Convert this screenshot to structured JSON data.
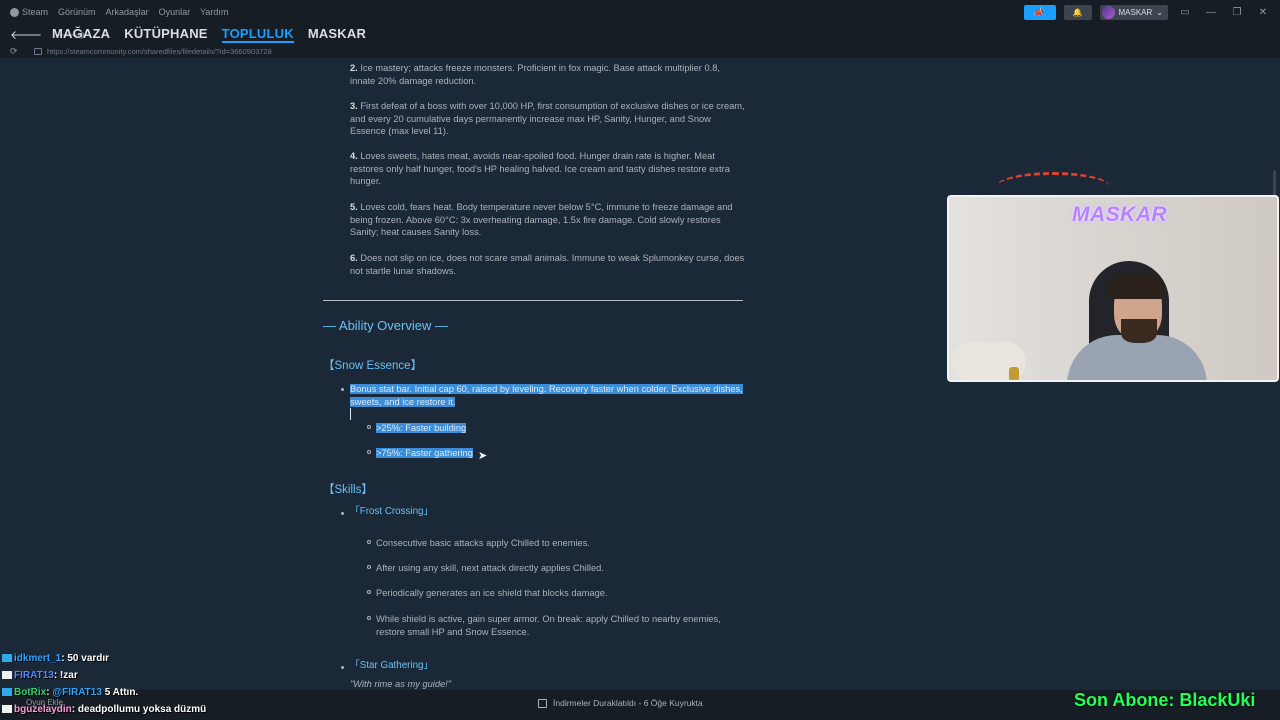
{
  "titlebar": {
    "menu": [
      "Steam",
      "Görünüm",
      "Arkadaşlar",
      "Oyunlar",
      "Yardım"
    ],
    "announce_icon": "megaphone-icon",
    "bell_icon": "bell-icon",
    "profile_name": "MASKAR",
    "profile_caret": "⌄",
    "window_controls": [
      "▭",
      "—",
      "❐",
      "✕"
    ]
  },
  "nav": {
    "back": "🡐",
    "forward": "🡒",
    "tabs": [
      "MAĞAZA",
      "KÜTÜPHANE",
      "TOPLULUK",
      "MASKAR"
    ],
    "active_tab": "TOPLULUK"
  },
  "urlbar": {
    "reload": "⟳",
    "url": "https://steamcommunity.com/sharedfiles/filedetails/?id=3660903728"
  },
  "article": {
    "traits": [
      {
        "num": "2.",
        "text": "Ice mastery; attacks freeze monsters. Proficient in fox magic. Base attack multiplier 0.8, innate 20% damage reduction."
      },
      {
        "num": "3.",
        "text": "First defeat of a boss with over 10,000 HP, first consumption of exclusive dishes or ice cream, and every 20 cumulative days permanently increase max HP, Sanity, Hunger, and Snow Essence (max level 11)."
      },
      {
        "num": "4.",
        "text": "Loves sweets, hates meat, avoids near-spoiled food. Hunger drain rate is higher. Meat restores only half hunger, food's HP healing halved. Ice cream and tasty dishes restore extra hunger."
      },
      {
        "num": "5.",
        "text": "Loves cold, fears heat. Body temperature never below 5°C, immune to freeze damage and being frozen. Above 60°C: 3x overheating damage, 1.5x fire damage. Cold slowly restores Sanity; heat causes Sanity loss."
      },
      {
        "num": "6.",
        "text": "Does not slip on ice, does not scare small animals. Immune to weak Splumonkey curse, does not startle lunar shadows."
      }
    ],
    "section_title": "— Ability Overview —",
    "snow_essence_title": "【Snow Essence】",
    "snow_essence_text": "Bonus stat bar. Initial cap 60, raised by leveling. Recovery faster when colder. Exclusive dishes, sweets, and ice restore it.",
    "snow_sub": [
      ">25%: Faster building",
      ">75%: Faster gathering"
    ],
    "skills_title": "【Skills】",
    "skill1_name": "「Frost Crossing」",
    "skill1_items": [
      "Consecutive basic attacks apply Chilled to enemies.",
      "After using any skill, next attack directly applies Chilled.",
      "Periodically generates an ice shield that blocks damage.",
      "While shield is active, gain super armor. On break: apply Chilled to nearby enemies, restore small HP and Snow Essence."
    ],
    "skill2_name": "「Star Gathering」",
    "skill2_quote": "\"With rime as my guide!\""
  },
  "webcam": {
    "title": "MASKAR"
  },
  "chat": [
    {
      "user": "idkmert_1",
      "message": ": 50 vardır"
    },
    {
      "user": "FIRAT13",
      "message": ": !zar"
    },
    {
      "user": "BotRix",
      "message": ": ",
      "mention": "@FIRAT13",
      "rest": " 5 Attın."
    },
    {
      "user": "bguzelaydin",
      "message": ": deadpollumu yoksa düzmü"
    }
  ],
  "bottom": {
    "add_game": "Oyun Ekle",
    "downloads": "İndirmeler Duraklatıldı - 6 Öğe Kuyrukta",
    "son_abone": "Son Abone: BlackUki"
  }
}
